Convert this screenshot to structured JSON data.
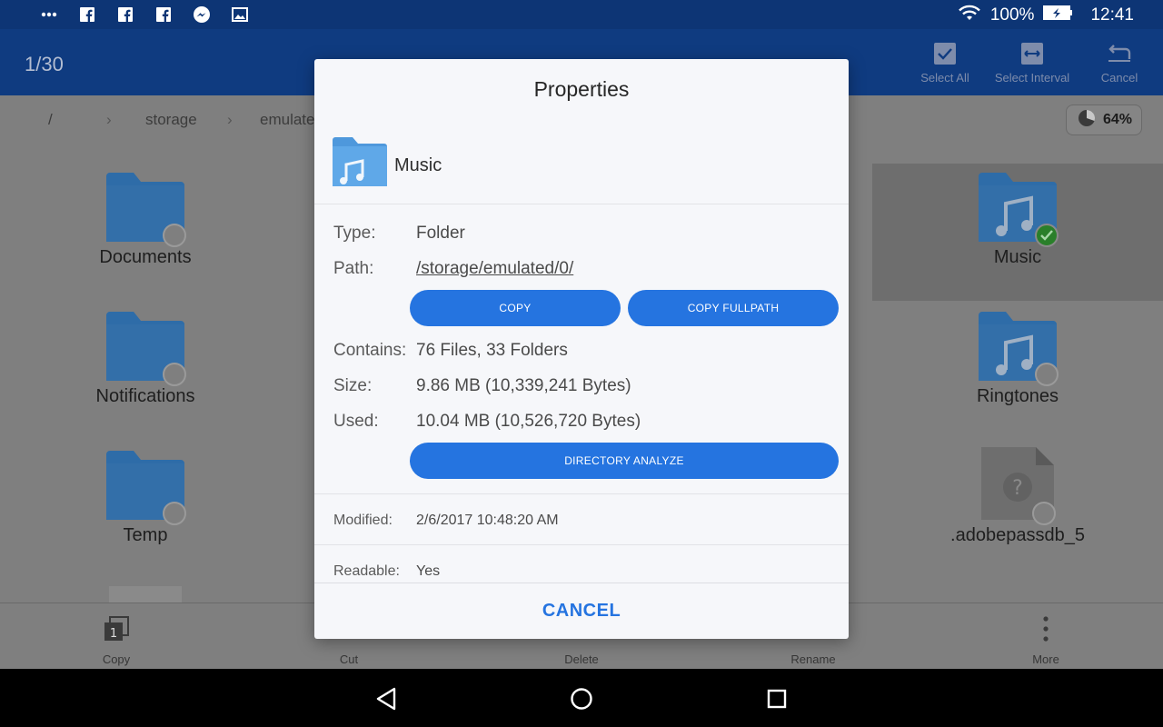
{
  "status_bar": {
    "icons": [
      "more-icon",
      "facebook-icon",
      "facebook-icon",
      "facebook-icon",
      "messenger-icon",
      "gallery-icon"
    ],
    "battery": "100%",
    "time": "12:41"
  },
  "app_bar": {
    "selection_count": "1/30",
    "select_all": "Select All",
    "select_interval": "Select Interval",
    "cancel": "Cancel"
  },
  "path_bar": {
    "crumbs": [
      "/",
      "storage",
      "emulated"
    ],
    "usage": "64%"
  },
  "grid": {
    "items": [
      {
        "name": "Documents"
      },
      {
        "name": "Music"
      },
      {
        "name": "Notifications"
      },
      {
        "name": "Ringtones"
      },
      {
        "name": "Temp"
      },
      {
        "name": ".adobepassdb_5"
      }
    ]
  },
  "toolbar": {
    "copy": "Copy",
    "copy_badge": "1",
    "cut": "Cut",
    "delete": "Delete",
    "rename": "Rename",
    "more": "More"
  },
  "dialog": {
    "title": "Properties",
    "name": "Music",
    "type_label": "Type:",
    "type_value": "Folder",
    "path_label": "Path:",
    "path_value": "/storage/emulated/0/",
    "copy_button": "COPY",
    "copy_fullpath_button": "COPY FULLPATH",
    "contains_label": "Contains:",
    "contains_value": "76 Files, 33 Folders",
    "size_label": "Size:",
    "size_value": "9.86 MB (10,339,241 Bytes)",
    "used_label": "Used:",
    "used_value": "10.04 MB (10,526,720 Bytes)",
    "analyze_button": "DIRECTORY ANALYZE",
    "modified_label": "Modified:",
    "modified_value": "2/6/2017 10:48:20 AM",
    "readable_label": "Readable:",
    "readable_value": "Yes",
    "cancel_button": "CANCEL"
  },
  "colors": {
    "accent": "#2574e0",
    "link": "#1d8f7f",
    "folder": "#5fa8e8",
    "selected_check": "#2a7f2a"
  }
}
